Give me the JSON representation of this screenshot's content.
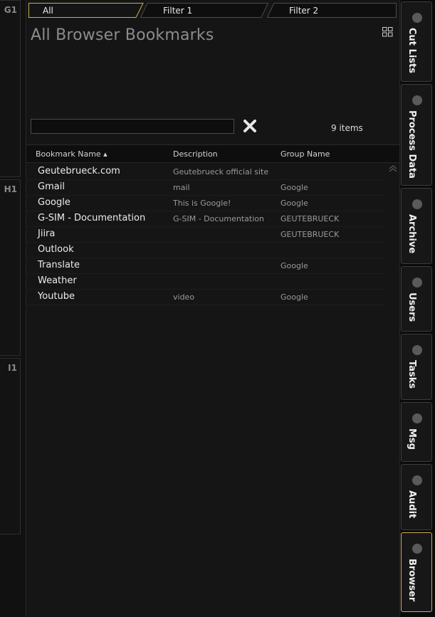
{
  "left_panels": [
    "G1",
    "H1",
    "I1"
  ],
  "tabs": [
    {
      "label": "All",
      "active": true
    },
    {
      "label": "Filter 1",
      "active": false
    },
    {
      "label": "Filter 2",
      "active": false
    }
  ],
  "header": {
    "title": "All Browser Bookmarks",
    "view_icon": "grid-view-icon"
  },
  "search": {
    "value": "",
    "placeholder": ""
  },
  "item_count": "9 items",
  "columns": [
    "Bookmark Name ▴",
    "Description",
    "Group Name"
  ],
  "bookmarks": [
    {
      "name": "Geutebrueck.com",
      "description": "Geutebrueck official site",
      "group": ""
    },
    {
      "name": "Gmail",
      "description": "mail",
      "group": "Google"
    },
    {
      "name": "Google",
      "description": "This is Google!",
      "group": "Google"
    },
    {
      "name": "G-SIM - Documentation",
      "description": "G-SIM - Documentation",
      "group": "GEUTEBRUECK"
    },
    {
      "name": "Jiira",
      "description": "",
      "group": "GEUTEBRUECK"
    },
    {
      "name": "Outlook",
      "description": "",
      "group": ""
    },
    {
      "name": "Translate",
      "description": "",
      "group": "Google"
    },
    {
      "name": "Weather",
      "description": "",
      "group": ""
    },
    {
      "name": "Youtube",
      "description": "video",
      "group": "Google"
    }
  ],
  "right_tabs": [
    {
      "label": "Cut Lists",
      "active": false
    },
    {
      "label": "Process Data",
      "active": false
    },
    {
      "label": "Archive",
      "active": false
    },
    {
      "label": "Users",
      "active": false
    },
    {
      "label": "Tasks",
      "active": false
    },
    {
      "label": "Msg",
      "active": false
    },
    {
      "label": "Audit",
      "active": false
    },
    {
      "label": "Browser",
      "active": true
    }
  ],
  "colors": {
    "accent": "#c9ad55",
    "background": "#151515",
    "text": "#ececec",
    "muted": "#9a9a9a"
  }
}
